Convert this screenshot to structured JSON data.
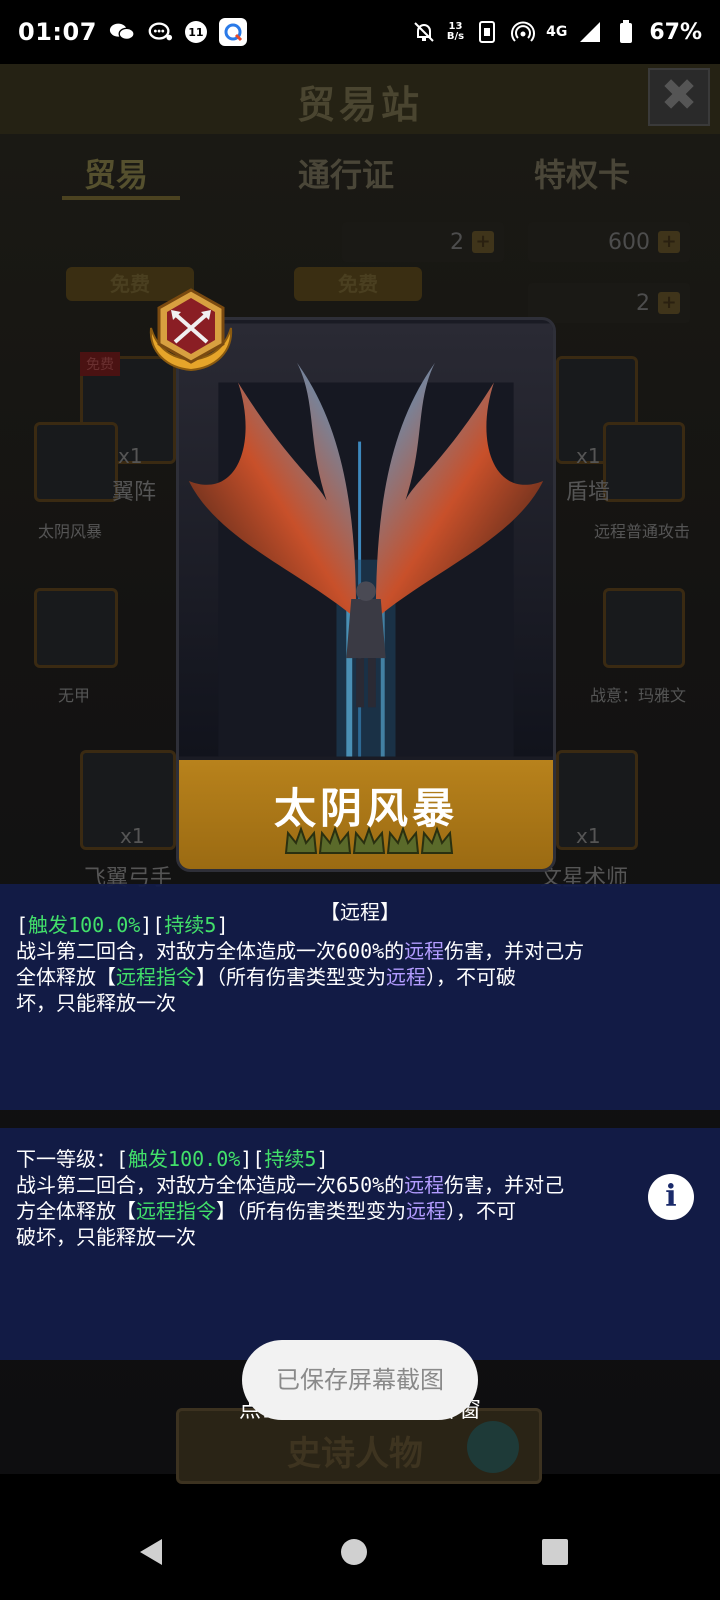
{
  "status_bar": {
    "time": "01:07",
    "notification_count": "11",
    "net_speed_value": "13",
    "net_speed_unit": "B/s",
    "network_type": "4G",
    "battery": "67%"
  },
  "game": {
    "title": "贸易站",
    "close": "✖",
    "tabs": [
      "贸易",
      "通行证",
      "特权卡"
    ],
    "resources": [
      "2",
      "600",
      "2"
    ],
    "free_label": "免费",
    "side_cards": {
      "left_top_label": "太阴风暴",
      "right_top_label": "远程普通攻击",
      "left_mid_label": "无甲",
      "right_mid_label": "战意：玛雅文",
      "left_name": "翼阵",
      "right_name": "盾墙",
      "left_bottom_name": "飞翼弓手",
      "right_bottom_name": "文星术师",
      "count": "x1",
      "free_tag": "免费"
    }
  },
  "card": {
    "name": "太阴风暴",
    "stars": 5
  },
  "description": {
    "type_title": "【远程】",
    "current": {
      "trigger_label": "触发100.0%",
      "duration_label": "持续5",
      "line2_a": "战斗第二回合，对敌方全体造成一次600%的",
      "ranged_word": "远程",
      "line2_b": "伤害，并对己方",
      "line3_a": "全体释放【",
      "command": "远程指令",
      "line3_b": "】（所有伤害类型变为",
      "line3_c": "），不可破",
      "line4": "坏，只能释放一次"
    },
    "next": {
      "prefix": "下一等级：",
      "trigger_label": "触发100.0%",
      "duration_label": "持续5",
      "line2_a": "战斗第二回合，对敌方全体造成一次650%的",
      "ranged_word": "远程",
      "line2_b": "伤害，并对己",
      "line3_a": "方全体释放【",
      "command": "远程指令",
      "line3_b": "】（所有伤害类型变为",
      "line3_c": "），不可",
      "line4": "破坏，只能释放一次"
    }
  },
  "hint": "点击弹窗外区域关闭弹窗",
  "epic_button": "史诗人物",
  "toast": "已保存屏幕截图",
  "colors": {
    "green": "#42e06a",
    "purple": "#b39cff",
    "panel": "#121c4a",
    "gold": "#b8821c"
  }
}
